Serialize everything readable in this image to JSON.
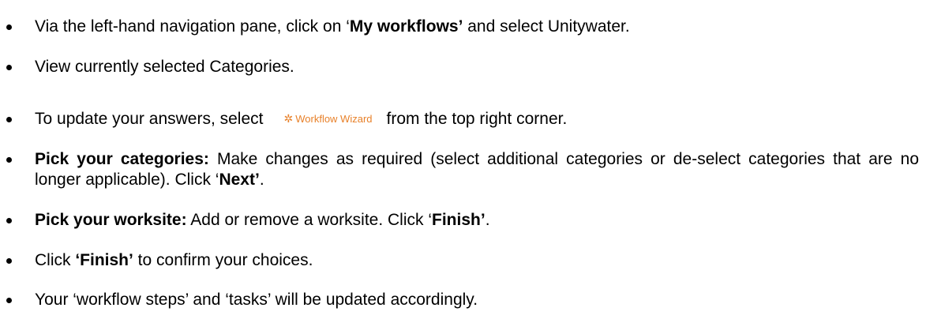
{
  "items": [
    {
      "p1": "Via the left-hand navigation pane, click on ‘",
      "b1": "My workflows’",
      "p2": " and select Unitywater."
    },
    {
      "p1": "View currently selected Categories."
    },
    {
      "p1": "To update your answers, select",
      "button_label": "Workflow Wizard",
      "button_icon": "gear-icon",
      "p2": "from the top right corner."
    },
    {
      "b1": "Pick your categories:",
      "p1": " Make changes as required (select additional categories or de-select categories that are no longer applicable). Click ‘",
      "b2": "Next’",
      "p2": "."
    },
    {
      "b1": "Pick your worksite:",
      "p1": " Add or remove a worksite. Click ‘",
      "b2": "Finish’",
      "p2": "."
    },
    {
      "p1": "Click ",
      "b1": "‘Finish’",
      "p2": " to confirm your choices."
    },
    {
      "p1": "Your ‘workflow steps’ and ‘tasks’ will be updated accordingly."
    }
  ],
  "colors": {
    "text": "#000000",
    "wizard_accent": "#e8812a"
  }
}
